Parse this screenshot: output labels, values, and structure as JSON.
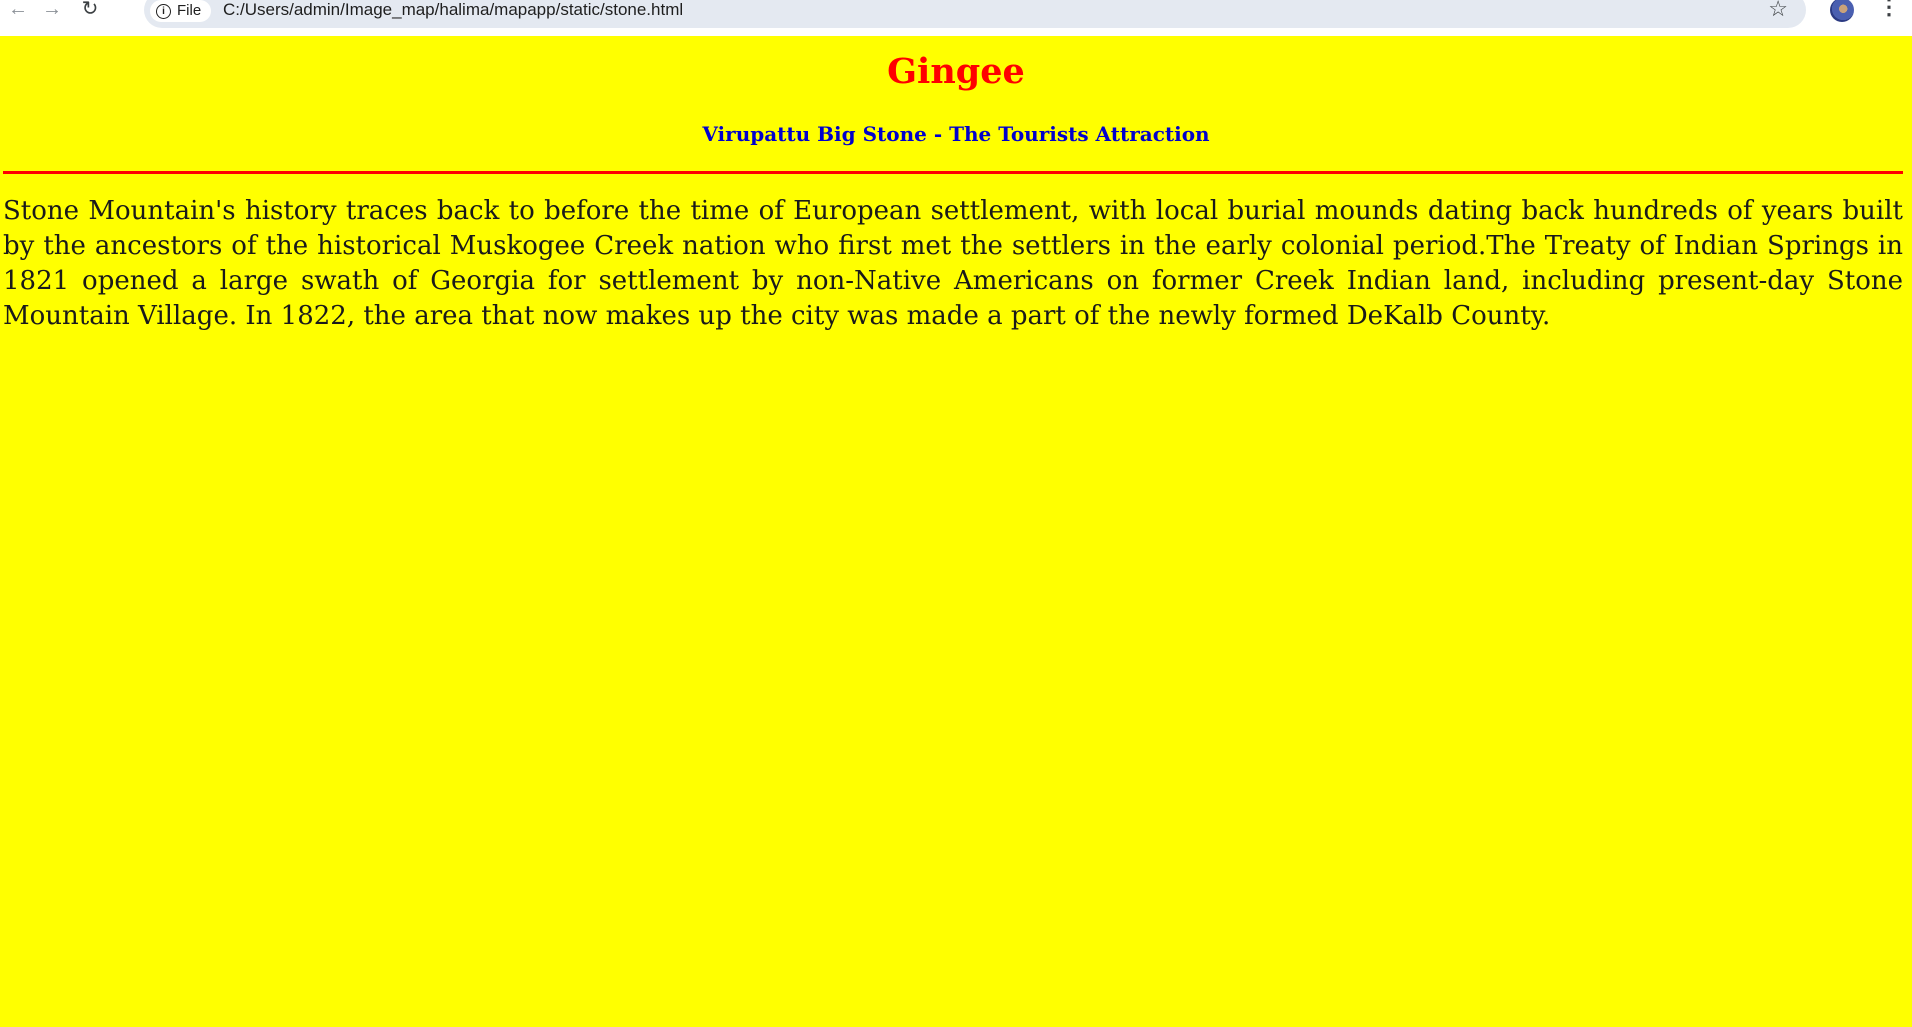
{
  "browser": {
    "back_icon": "←",
    "forward_icon": "→",
    "reload_icon": "↻",
    "site_chip_label": "File",
    "url": "C:/Users/admin/Image_map/halima/mapapp/static/stone.html",
    "star_icon": "☆",
    "menu_icon": "⋮"
  },
  "page": {
    "title": "Gingee",
    "subtitle": "Virupattu Big Stone - The Tourists Attraction",
    "paragraph": "Stone Mountain's history traces back to before the time of European settlement, with local burial mounds dating back hundreds of years built by the ancestors of the historical Muskogee Creek nation who first met the settlers in the early colonial period.The Treaty of Indian Springs in 1821 opened a large swath of Georgia for settlement by non-Native Americans on former Creek Indian land, including present-day Stone Mountain Village. In 1822, the area that now makes up the city was made a part of the newly formed DeKalb County."
  },
  "colors": {
    "background": "#ffff00",
    "title": "#ff0000",
    "subtitle": "#0000cc",
    "divider": "#ff0000"
  }
}
